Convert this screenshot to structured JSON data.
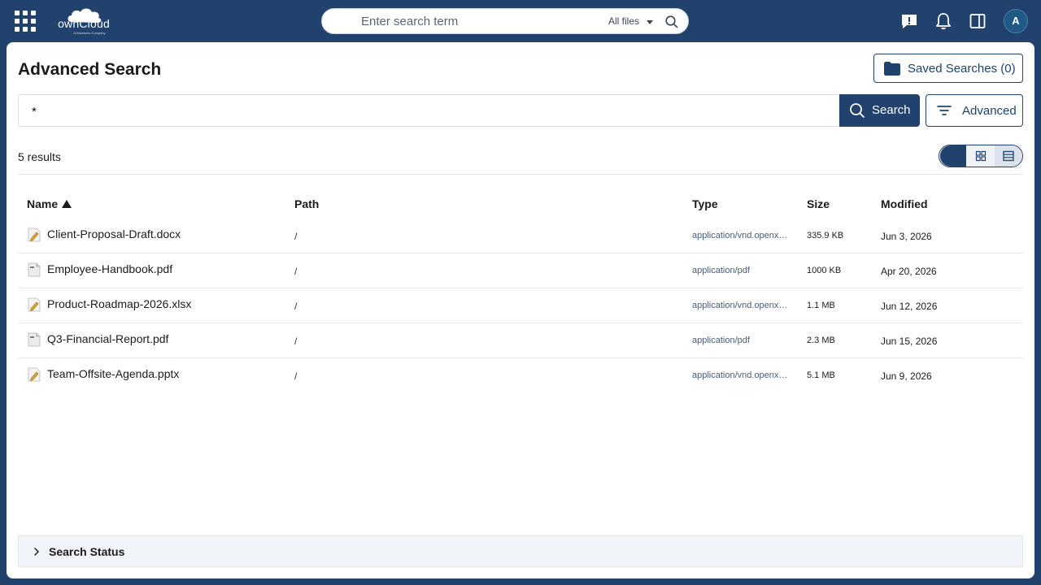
{
  "header": {
    "logo_text": "ownCloud",
    "logo_subtext": "A Kiteworks Company",
    "search_placeholder": "Enter search term",
    "search_scope": "All files",
    "avatar_initial": "A"
  },
  "page": {
    "title": "Advanced Search",
    "saved_searches_label": "Saved Searches (0)",
    "query_value": "*",
    "search_button_label": "Search",
    "advanced_button_label": "Advanced",
    "results_count": "5 results"
  },
  "table": {
    "columns": {
      "name": "Name",
      "path": "Path",
      "type": "Type",
      "size": "Size",
      "modified": "Modified"
    },
    "sort": {
      "column": "name",
      "direction": "ascending"
    },
    "rows": [
      {
        "name": "Client-Proposal-Draft.docx",
        "path": "/",
        "type": "application/vnd.openxmlformats-officedocument.wordprocessingml.document",
        "size": "335.9 KB",
        "modified": "Jun 3, 2026",
        "icon": "document-edit-icon"
      },
      {
        "name": "Employee-Handbook.pdf",
        "path": "/",
        "type": "application/pdf",
        "size": "1000 KB",
        "modified": "Apr 20, 2026",
        "icon": "pdf-file-icon"
      },
      {
        "name": "Product-Roadmap-2026.xlsx",
        "path": "/",
        "type": "application/vnd.openxmlformats-officedocument.spreadsheetml.sheet",
        "size": "1.1 MB",
        "modified": "Jun 12, 2026",
        "icon": "document-edit-icon"
      },
      {
        "name": "Q3-Financial-Report.pdf",
        "path": "/",
        "type": "application/pdf",
        "size": "2.3 MB",
        "modified": "Jun 15, 2026",
        "icon": "pdf-file-icon"
      },
      {
        "name": "Team-Offsite-Agenda.pptx",
        "path": "/",
        "type": "application/vnd.openxmlformats-officedocument.presentationml.presentation",
        "size": "5.1 MB",
        "modified": "Jun 9, 2026",
        "icon": "document-edit-icon"
      }
    ]
  },
  "status": {
    "label": "Search Status"
  },
  "colors": {
    "brand": "#20426d",
    "panel": "#ffffff",
    "status_bg": "#f1f4f9"
  }
}
